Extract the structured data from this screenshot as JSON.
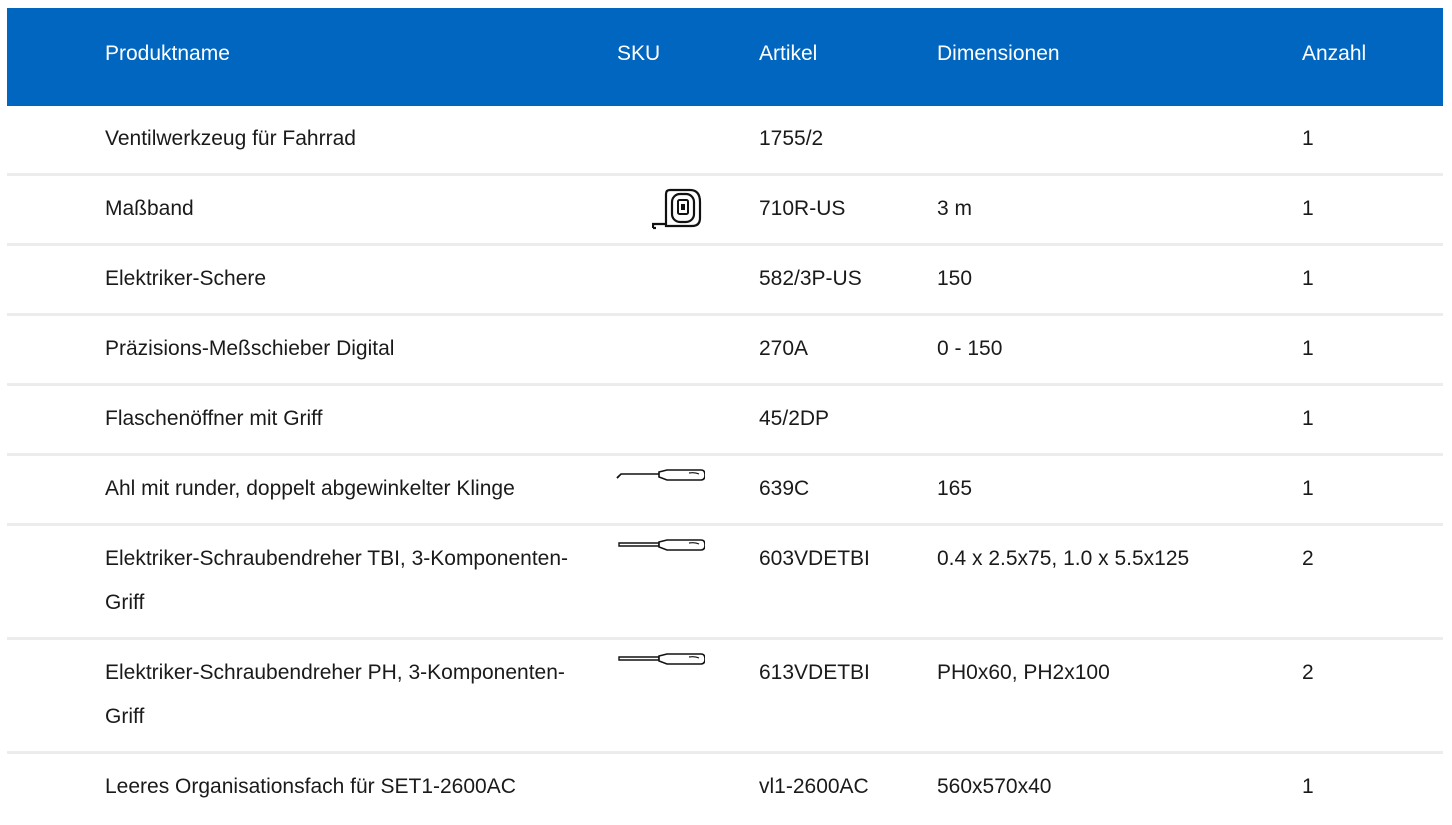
{
  "header": {
    "name": "Produktname",
    "sku": "SKU",
    "article": "Artikel",
    "dimensions": "Dimensionen",
    "quantity": "Anzahl"
  },
  "rows": [
    {
      "name": "Ventilwerkzeug für Fahrrad",
      "sku_icon": "",
      "article": "1755/2",
      "dimensions": "",
      "quantity": "1"
    },
    {
      "name": "Maßband",
      "sku_icon": "tape-measure-icon",
      "article": "710R-US",
      "dimensions": "3 m",
      "quantity": "1"
    },
    {
      "name": "Elektriker-Schere",
      "sku_icon": "",
      "article": "582/3P-US",
      "dimensions": "150",
      "quantity": "1"
    },
    {
      "name": "Präzisions-Meßschieber Digital",
      "sku_icon": "",
      "article": "270A",
      "dimensions": "0 - 150",
      "quantity": "1"
    },
    {
      "name": "Flaschenöffner mit Griff",
      "sku_icon": "",
      "article": "45/2DP",
      "dimensions": "",
      "quantity": "1"
    },
    {
      "name": "Ahl mit runder, doppelt abgewinkelter Klinge",
      "sku_icon": "awl-icon",
      "article": "639C",
      "dimensions": "165",
      "quantity": "1"
    },
    {
      "name": "Elektriker-Schraubendreher TBI, 3-Komponenten-Griff",
      "sku_icon": "screwdriver-icon",
      "article": "603VDETBI",
      "dimensions": "0.4 x 2.5x75, 1.0 x 5.5x125",
      "quantity": "2"
    },
    {
      "name": "Elektriker-Schraubendreher PH, 3-Komponenten-Griff",
      "sku_icon": "screwdriver-icon",
      "article": "613VDETBI",
      "dimensions": "PH0x60, PH2x100",
      "quantity": "2"
    },
    {
      "name": "Leeres Organisationsfach für SET1-2600AC",
      "sku_icon": "",
      "article": "vl1-2600AC",
      "dimensions": "560x570x40",
      "quantity": "1"
    }
  ],
  "colors": {
    "header_bg": "#0066bf",
    "header_text": "#ffffff",
    "row_divider": "#ececec"
  }
}
